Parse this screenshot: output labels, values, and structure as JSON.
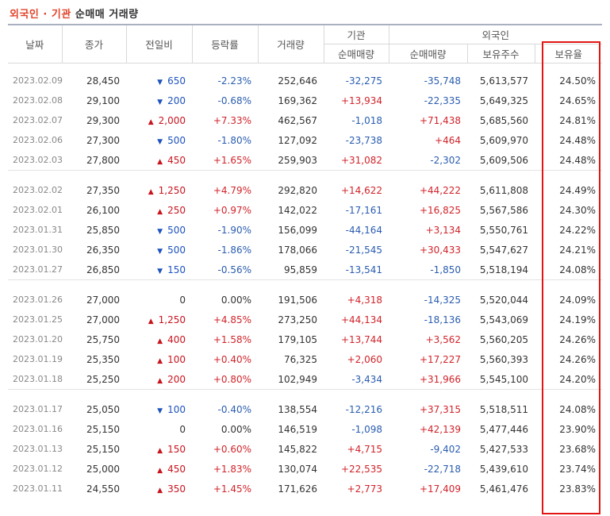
{
  "title": {
    "part1": "외국인",
    "sep": "·",
    "part2": "기관",
    "part3": "순매매 거래량"
  },
  "headers": {
    "date": "날짜",
    "close": "종가",
    "change": "전일비",
    "rate": "등락률",
    "volume": "거래량",
    "institution": "기관",
    "inst_net": "순매매량",
    "foreign": "외국인",
    "for_net": "순매매량",
    "holdings": "보유주수",
    "ratio": "보유율"
  },
  "groups": [
    [
      {
        "date": "2023.02.09",
        "close": "28,450",
        "dir": "down",
        "change": "650",
        "rate": "-2.23%",
        "volume": "252,646",
        "inst": "-32,275",
        "foreign": "-35,748",
        "holdings": "5,613,577",
        "ratio": "24.50%"
      },
      {
        "date": "2023.02.08",
        "close": "29,100",
        "dir": "down",
        "change": "200",
        "rate": "-0.68%",
        "volume": "169,362",
        "inst": "+13,934",
        "foreign": "-22,335",
        "holdings": "5,649,325",
        "ratio": "24.65%"
      },
      {
        "date": "2023.02.07",
        "close": "29,300",
        "dir": "up",
        "change": "2,000",
        "rate": "+7.33%",
        "volume": "462,567",
        "inst": "-1,018",
        "foreign": "+71,438",
        "holdings": "5,685,560",
        "ratio": "24.81%"
      },
      {
        "date": "2023.02.06",
        "close": "27,300",
        "dir": "down",
        "change": "500",
        "rate": "-1.80%",
        "volume": "127,092",
        "inst": "-23,738",
        "foreign": "+464",
        "holdings": "5,609,970",
        "ratio": "24.48%"
      },
      {
        "date": "2023.02.03",
        "close": "27,800",
        "dir": "up",
        "change": "450",
        "rate": "+1.65%",
        "volume": "259,903",
        "inst": "+31,082",
        "foreign": "-2,302",
        "holdings": "5,609,506",
        "ratio": "24.48%"
      }
    ],
    [
      {
        "date": "2023.02.02",
        "close": "27,350",
        "dir": "up",
        "change": "1,250",
        "rate": "+4.79%",
        "volume": "292,820",
        "inst": "+14,622",
        "foreign": "+44,222",
        "holdings": "5,611,808",
        "ratio": "24.49%"
      },
      {
        "date": "2023.02.01",
        "close": "26,100",
        "dir": "up",
        "change": "250",
        "rate": "+0.97%",
        "volume": "142,022",
        "inst": "-17,161",
        "foreign": "+16,825",
        "holdings": "5,567,586",
        "ratio": "24.30%"
      },
      {
        "date": "2023.01.31",
        "close": "25,850",
        "dir": "down",
        "change": "500",
        "rate": "-1.90%",
        "volume": "156,099",
        "inst": "-44,164",
        "foreign": "+3,134",
        "holdings": "5,550,761",
        "ratio": "24.22%"
      },
      {
        "date": "2023.01.30",
        "close": "26,350",
        "dir": "down",
        "change": "500",
        "rate": "-1.86%",
        "volume": "178,066",
        "inst": "-21,545",
        "foreign": "+30,433",
        "holdings": "5,547,627",
        "ratio": "24.21%"
      },
      {
        "date": "2023.01.27",
        "close": "26,850",
        "dir": "down",
        "change": "150",
        "rate": "-0.56%",
        "volume": "95,859",
        "inst": "-13,541",
        "foreign": "-1,850",
        "holdings": "5,518,194",
        "ratio": "24.08%"
      }
    ],
    [
      {
        "date": "2023.01.26",
        "close": "27,000",
        "dir": "none",
        "change": "0",
        "rate": "0.00%",
        "volume": "191,506",
        "inst": "+4,318",
        "foreign": "-14,325",
        "holdings": "5,520,044",
        "ratio": "24.09%"
      },
      {
        "date": "2023.01.25",
        "close": "27,000",
        "dir": "up",
        "change": "1,250",
        "rate": "+4.85%",
        "volume": "273,250",
        "inst": "+44,134",
        "foreign": "-18,136",
        "holdings": "5,543,069",
        "ratio": "24.19%"
      },
      {
        "date": "2023.01.20",
        "close": "25,750",
        "dir": "up",
        "change": "400",
        "rate": "+1.58%",
        "volume": "179,105",
        "inst": "+13,744",
        "foreign": "+3,562",
        "holdings": "5,560,205",
        "ratio": "24.26%"
      },
      {
        "date": "2023.01.19",
        "close": "25,350",
        "dir": "up",
        "change": "100",
        "rate": "+0.40%",
        "volume": "76,325",
        "inst": "+2,060",
        "foreign": "+17,227",
        "holdings": "5,560,393",
        "ratio": "24.26%"
      },
      {
        "date": "2023.01.18",
        "close": "25,250",
        "dir": "up",
        "change": "200",
        "rate": "+0.80%",
        "volume": "102,949",
        "inst": "-3,434",
        "foreign": "+31,966",
        "holdings": "5,545,100",
        "ratio": "24.20%"
      }
    ],
    [
      {
        "date": "2023.01.17",
        "close": "25,050",
        "dir": "down",
        "change": "100",
        "rate": "-0.40%",
        "volume": "138,554",
        "inst": "-12,216",
        "foreign": "+37,315",
        "holdings": "5,518,511",
        "ratio": "24.08%"
      },
      {
        "date": "2023.01.16",
        "close": "25,150",
        "dir": "none",
        "change": "0",
        "rate": "0.00%",
        "volume": "146,519",
        "inst": "-1,098",
        "foreign": "+42,139",
        "holdings": "5,477,446",
        "ratio": "23.90%"
      },
      {
        "date": "2023.01.13",
        "close": "25,150",
        "dir": "up",
        "change": "150",
        "rate": "+0.60%",
        "volume": "145,822",
        "inst": "+4,715",
        "foreign": "-9,402",
        "holdings": "5,427,533",
        "ratio": "23.68%"
      },
      {
        "date": "2023.01.12",
        "close": "25,000",
        "dir": "up",
        "change": "450",
        "rate": "+1.83%",
        "volume": "130,074",
        "inst": "+22,535",
        "foreign": "-22,718",
        "holdings": "5,439,610",
        "ratio": "23.74%"
      },
      {
        "date": "2023.01.11",
        "close": "24,550",
        "dir": "up",
        "change": "350",
        "rate": "+1.45%",
        "volume": "171,626",
        "inst": "+2,773",
        "foreign": "+17,409",
        "holdings": "5,461,476",
        "ratio": "23.83%"
      }
    ]
  ],
  "colors": {
    "up": "#c8141f",
    "down": "#1d53bd",
    "highlight_box": "#e41515",
    "title_accent": "#e0452b"
  },
  "icons": {
    "up": "up-triangle-icon",
    "down": "down-triangle-icon"
  }
}
